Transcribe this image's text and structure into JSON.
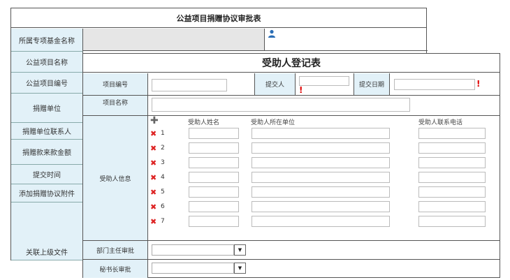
{
  "back_form": {
    "title": "公益项目捐赠协议审批表",
    "labels": [
      "所属专项基金名称",
      "公益项目名称",
      "公益项目编号",
      "捐赠单位",
      "捐赠单位联系人",
      "捐赠款来款金额",
      "提交时间",
      "添加捐赠协议附件",
      "关联上级文件"
    ],
    "user_icon": "user-icon"
  },
  "front_form": {
    "title": "受助人登记表",
    "project_no_label": "项目编号",
    "submitter_label": "提交人",
    "submit_date_label": "提交日期",
    "project_name_label": "项目名称",
    "recipient_info_label": "受助人信息",
    "columns": {
      "name": "受助人姓名",
      "unit": "受助人所在单位",
      "phone": "受助人联系电话"
    },
    "rows": [
      "1",
      "2",
      "3",
      "4",
      "5",
      "6",
      "7"
    ],
    "dept_approval_label": "部门主任审批",
    "sec_approval_label": "秘书长审批",
    "required_mark": "!",
    "delete_mark": "✖",
    "add_mark": "✚",
    "dropdown_arrow": "▼"
  },
  "colors": {
    "label_bg": "#e2f1f8",
    "required": "#e00000",
    "delete": "#d22222",
    "user_icon": "#2a6db5"
  }
}
